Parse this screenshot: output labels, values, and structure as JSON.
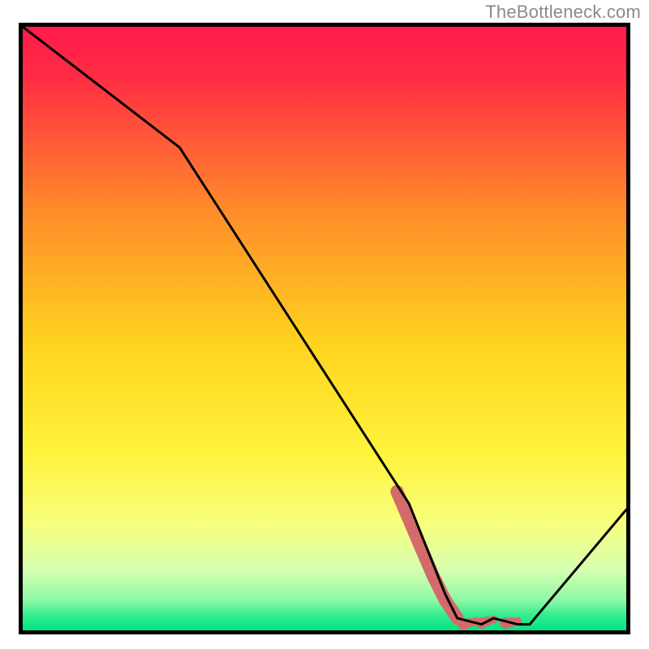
{
  "attribution": "TheBottleneck.com",
  "colors": {
    "gradient_top": "#ff1a4b",
    "gradient_mid_upper": "#ff6e29",
    "gradient_mid": "#ffd21f",
    "gradient_mid_lower": "#f9f56a",
    "gradient_lower": "#d9ffb8",
    "gradient_bottom": "#00e583",
    "line": "#000000",
    "accent": "#d46a6a",
    "border": "#000000"
  },
  "chart_data": {
    "type": "line",
    "title": "",
    "xlabel": "",
    "ylabel": "",
    "xlim": [
      0,
      100
    ],
    "ylim": [
      0,
      100
    ],
    "series": [
      {
        "name": "curve",
        "x": [
          0,
          26,
          64,
          70,
          72,
          76,
          78,
          82,
          84,
          100
        ],
        "values": [
          100,
          80,
          21,
          6,
          2,
          1,
          2,
          1,
          1,
          20
        ]
      }
    ],
    "accent_segment": {
      "x": [
        62,
        68,
        70,
        72,
        73,
        75,
        76,
        78,
        80,
        82
      ],
      "values": [
        23,
        9,
        5,
        2,
        1,
        1.5,
        1.2,
        1.8,
        1.2,
        1.5
      ]
    },
    "annotations": []
  }
}
